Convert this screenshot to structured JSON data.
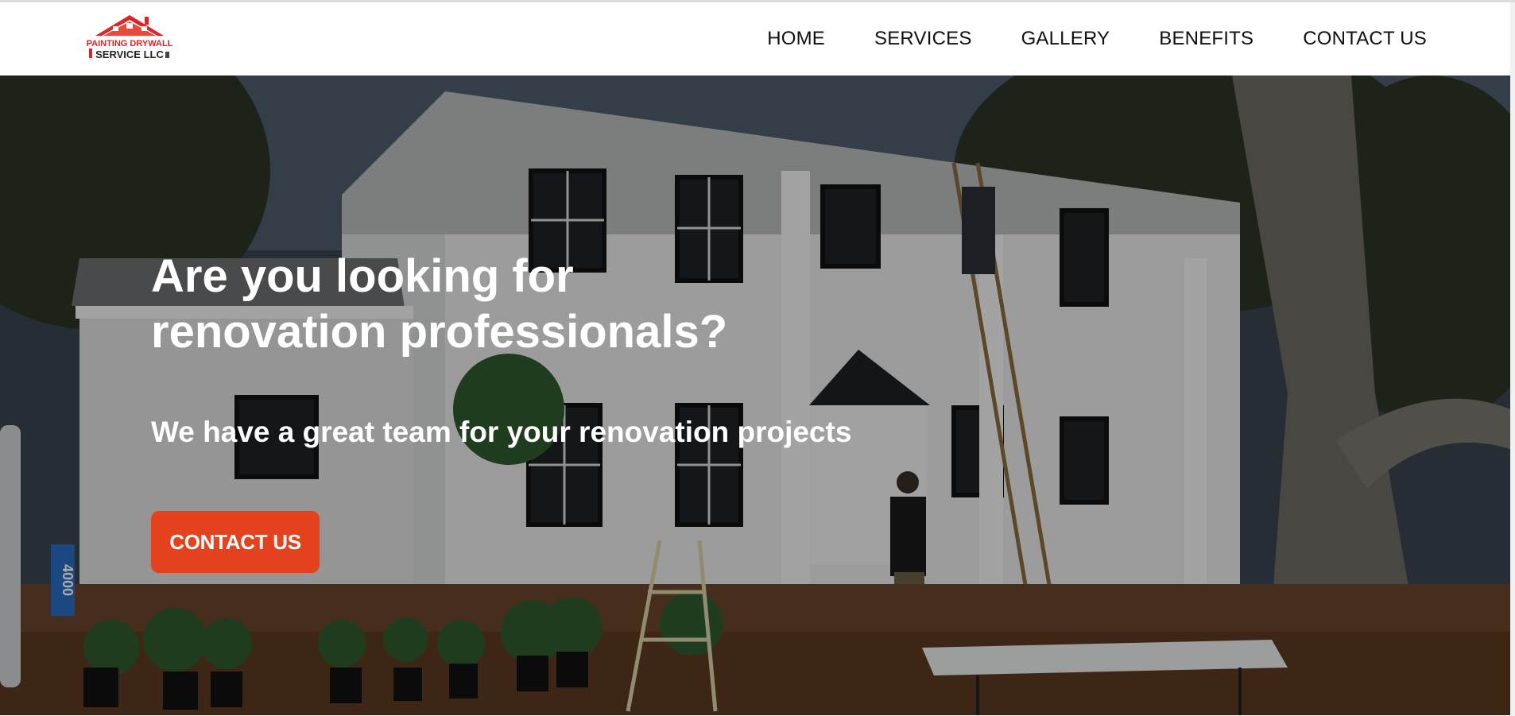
{
  "brand": {
    "logo_line1": "PAINTING DRYWALL",
    "logo_line2": "SERVICE LLC",
    "accent_color": "#e4411f"
  },
  "nav": {
    "items": [
      {
        "label": "HOME"
      },
      {
        "label": "SERVICES"
      },
      {
        "label": "GALLERY"
      },
      {
        "label": "BENEFITS"
      },
      {
        "label": "CONTACT US"
      }
    ]
  },
  "hero": {
    "headline_line1": "Are you looking for",
    "headline_line2": "renovation professionals?",
    "subheadline": "We have a great team for your renovation projects",
    "cta_label": "CONTACT US",
    "mailbox_number": "4000"
  },
  "icons": {
    "logo": "house-roof-logo-icon"
  }
}
